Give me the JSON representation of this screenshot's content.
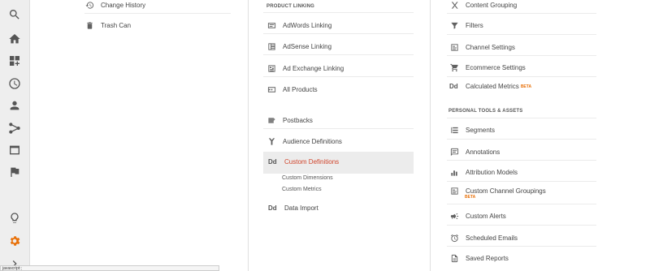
{
  "rail": {
    "icons": [
      "search-icon",
      "home-icon",
      "customization-icon",
      "reports-clock-icon",
      "audience-person-icon",
      "acquisition-fork-icon",
      "behavior-window-icon",
      "conversions-flag-icon",
      "discover-bulb-icon",
      "admin-gear-icon",
      "expand-chevron-icon"
    ],
    "active_color": "#e8710a"
  },
  "column1": {
    "change_history": "Change History",
    "trash_can": "Trash Can"
  },
  "column2": {
    "section_title": "PRODUCT LINKING",
    "adwords": "AdWords Linking",
    "adsense": "AdSense Linking",
    "adexchange": "Ad Exchange Linking",
    "all_products": "All Products",
    "postbacks": "Postbacks",
    "audience_definitions": "Audience Definitions",
    "custom_definitions_dd": "Dd",
    "custom_definitions": "Custom Definitions",
    "custom_dimensions": "Custom Dimensions",
    "custom_metrics": "Custom Metrics",
    "data_import_dd": "Dd",
    "data_import": "Data Import"
  },
  "column3": {
    "content_grouping": "Content Grouping",
    "filters": "Filters",
    "channel_settings": "Channel Settings",
    "ecommerce_settings": "Ecommerce Settings",
    "calc_metrics_dd": "Dd",
    "calc_metrics": "Calculated Metrics",
    "beta1": "BETA",
    "section_title": "PERSONAL TOOLS & ASSETS",
    "segments": "Segments",
    "annotations": "Annotations",
    "attribution_models": "Attribution Models",
    "custom_channel_groupings": "Custom Channel Groupings",
    "beta2": "BETA",
    "custom_alerts": "Custom Alerts",
    "scheduled_emails": "Scheduled Emails",
    "saved_reports": "Saved Reports"
  },
  "status_bar": {
    "text": "javascript:;"
  },
  "colors": {
    "accent": "#e8710a",
    "selected_text": "#d0452c"
  }
}
